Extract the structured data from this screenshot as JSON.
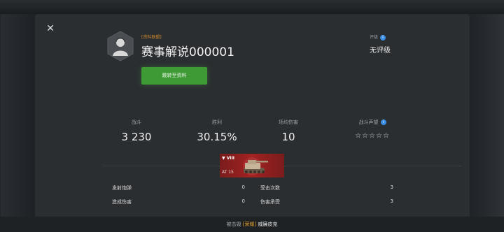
{
  "dialog": {
    "close_icon": "close-icon"
  },
  "player": {
    "clan_tag": "[资料联盟]",
    "name": "赛事解说000001",
    "profile_button": "跳转至资料"
  },
  "rating": {
    "label": "评级",
    "value": "无评级"
  },
  "stats": [
    {
      "label": "战斗",
      "value": "3 230"
    },
    {
      "label": "胜利",
      "value": "30.15%"
    },
    {
      "label": "场均伤害",
      "value": "10"
    },
    {
      "label": "战斗声望",
      "value": "☆☆☆☆☆"
    }
  ],
  "tank": {
    "tier": "▼ VIII",
    "code": "AT 15"
  },
  "battle_stats": {
    "left": [
      {
        "label": "发射炮弹",
        "value": "0"
      },
      {
        "label": "造成伤害",
        "value": "0"
      }
    ],
    "right": [
      {
        "label": "受击次数",
        "value": "3"
      },
      {
        "label": "伤害承受",
        "value": "3"
      }
    ]
  },
  "footer": {
    "prefix": "被击毁",
    "tag": "[荣耀]",
    "tank_name": "威廉皮克"
  },
  "colors": {
    "accent_green": "#3d9a34",
    "clan_orange": "#d08a2a",
    "info_blue": "#3a8ee6",
    "badge_red": "#a32222"
  }
}
